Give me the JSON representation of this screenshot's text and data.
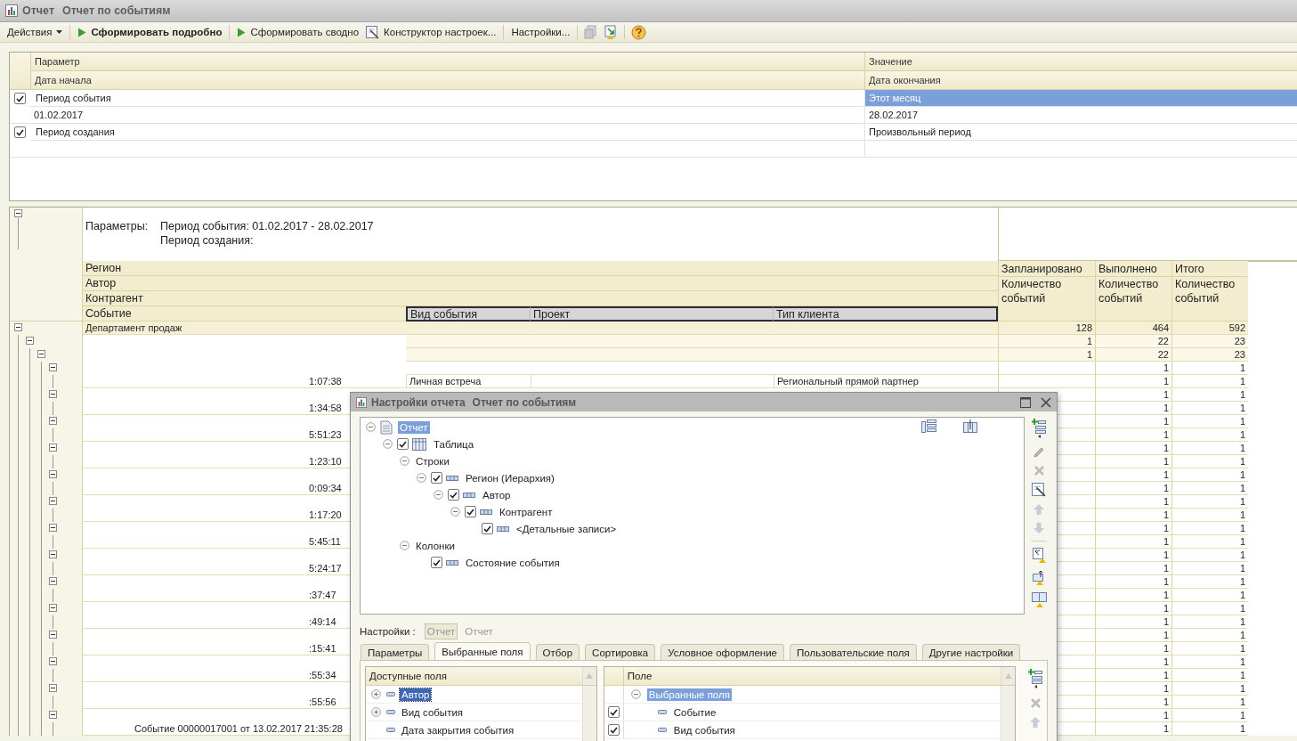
{
  "window": {
    "type": "Отчет",
    "title": "Отчет по событиям"
  },
  "toolbar": [
    {
      "kind": "menu",
      "label": "Действия"
    },
    {
      "kind": "separator"
    },
    {
      "kind": "run",
      "label": "Сформировать подробно",
      "bold": true
    },
    {
      "kind": "separator"
    },
    {
      "kind": "run",
      "label": "Сформировать сводно",
      "bold": false
    },
    {
      "kind": "wizard",
      "label": "Конструктор настроек..."
    },
    {
      "kind": "separator"
    },
    {
      "kind": "text",
      "label": "Настройки..."
    },
    {
      "kind": "separator"
    },
    {
      "kind": "load",
      "disabled": true
    },
    {
      "kind": "save",
      "disabled": false
    },
    {
      "kind": "separator"
    },
    {
      "kind": "help"
    }
  ],
  "parameters": {
    "columns": [
      "Параметр",
      "Значение"
    ],
    "subcolumns": [
      "Дата начала",
      "Дата окончания"
    ],
    "rows": [
      {
        "checked": true,
        "name": "Период события",
        "value": "Этот месяц",
        "selected": true,
        "start": "01.02.2017",
        "end": "28.02.2017"
      },
      {
        "checked": true,
        "name": "Период создания",
        "value": "Произвольный период",
        "selected": false
      }
    ]
  },
  "report": {
    "params_label": "Параметры:",
    "params": [
      "Период события: 01.02.2017 - 28.02.2017",
      "Период создания:"
    ],
    "expanded": true,
    "row_headers": [
      "Регион",
      "Автор",
      "Контрагент",
      "Событие"
    ],
    "event_columns": [
      "Вид события",
      "Проект",
      "Тип клиента"
    ],
    "measure_columns": [
      {
        "group": "Запланировано",
        "measure": "Количество событий"
      },
      {
        "group": "Выполнено",
        "measure": "Количество событий"
      },
      {
        "group": "Итого",
        "measure": "Количество событий"
      }
    ],
    "rows": [
      {
        "kind": "region",
        "label": "Департамент продаж",
        "expanded": true,
        "planned": "128",
        "done": "464",
        "total": "592",
        "children": [
          {
            "kind": "group",
            "expanded": true,
            "planned": "1",
            "done": "22",
            "total": "23",
            "children": [
              {
                "kind": "group",
                "expanded": true,
                "planned": "1",
                "done": "22",
                "total": "23",
                "children": [
                  {
                    "kind": "group",
                    "expanded": true,
                    "done": "1",
                    "total": "1",
                    "children": [
                      {
                        "kind": "event-partial",
                        "label": "1:07:38",
                        "event_type": "Личная встреча",
                        "client_type": "Региональный прямой партнер",
                        "done": "1",
                        "total": "1"
                      }
                    ]
                  },
                  {
                    "kind": "group",
                    "expanded": true,
                    "done": "1",
                    "total": "1",
                    "children": [
                      {
                        "kind": "event-partial",
                        "label": "1:34:58",
                        "done": "1",
                        "total": "1"
                      }
                    ]
                  },
                  {
                    "kind": "group",
                    "expanded": true,
                    "done": "1",
                    "total": "1",
                    "children": [
                      {
                        "kind": "event-partial",
                        "label": "5:51:23",
                        "done": "1",
                        "total": "1"
                      }
                    ]
                  },
                  {
                    "kind": "group",
                    "expanded": true,
                    "done": "1",
                    "total": "1",
                    "children": [
                      {
                        "kind": "event-partial",
                        "label": "1:23:10",
                        "done": "1",
                        "total": "1"
                      }
                    ]
                  },
                  {
                    "kind": "group",
                    "expanded": true,
                    "done": "1",
                    "total": "1",
                    "children": [
                      {
                        "kind": "event-partial",
                        "label": "0:09:34",
                        "done": "1",
                        "total": "1"
                      }
                    ]
                  },
                  {
                    "kind": "group",
                    "expanded": true,
                    "done": "1",
                    "total": "1",
                    "children": [
                      {
                        "kind": "event-partial",
                        "label": "1:17:20",
                        "done": "1",
                        "total": "1"
                      }
                    ]
                  },
                  {
                    "kind": "group",
                    "expanded": true,
                    "done": "1",
                    "total": "1",
                    "children": [
                      {
                        "kind": "event-partial",
                        "label": "5:45:11",
                        "done": "1",
                        "total": "1"
                      }
                    ]
                  },
                  {
                    "kind": "group",
                    "expanded": true,
                    "done": "1",
                    "total": "1",
                    "children": [
                      {
                        "kind": "event-partial",
                        "label": "5:24:17",
                        "done": "1",
                        "total": "1"
                      }
                    ]
                  },
                  {
                    "kind": "group",
                    "expanded": true,
                    "done": "1",
                    "total": "1",
                    "children": [
                      {
                        "kind": "event-partial",
                        "label": ":37:47",
                        "done": "1",
                        "total": "1"
                      }
                    ]
                  },
                  {
                    "kind": "group",
                    "expanded": true,
                    "done": "1",
                    "total": "1",
                    "children": [
                      {
                        "kind": "event-partial",
                        "label": ":49:14",
                        "done": "1",
                        "total": "1"
                      }
                    ]
                  },
                  {
                    "kind": "group",
                    "expanded": true,
                    "done": "1",
                    "total": "1",
                    "children": [
                      {
                        "kind": "event-partial",
                        "label": ":15:41",
                        "done": "1",
                        "total": "1"
                      }
                    ]
                  },
                  {
                    "kind": "group",
                    "expanded": true,
                    "done": "1",
                    "total": "1",
                    "children": [
                      {
                        "kind": "event-partial",
                        "label": ":55:34",
                        "done": "1",
                        "total": "1"
                      }
                    ]
                  },
                  {
                    "kind": "group",
                    "expanded": true,
                    "done": "1",
                    "total": "1",
                    "children": [
                      {
                        "kind": "event-partial",
                        "label": ":55:56",
                        "done": "1",
                        "total": "1"
                      }
                    ]
                  },
                  {
                    "kind": "group",
                    "expanded": true,
                    "done": "1",
                    "total": "1",
                    "children": [
                      {
                        "kind": "event",
                        "label": "Событие 00000017001 от 13.02.2017 21:35:28",
                        "done": "1",
                        "total": "1"
                      }
                    ]
                  }
                ]
              }
            ]
          }
        ]
      }
    ]
  },
  "settings_dialog": {
    "type": "Настройки отчета",
    "title": "Отчет по событиям",
    "tree": [
      {
        "kind": "report",
        "label": "Отчет",
        "selected": true,
        "expanded": true,
        "children": [
          {
            "kind": "table",
            "label": "Таблица",
            "checked": true,
            "expanded": true,
            "children": [
              {
                "label": "Строки",
                "expanded": true,
                "children": [
                  {
                    "kind": "field",
                    "label": "Регион (Иерархия)",
                    "checked": true,
                    "expanded": true,
                    "children": [
                      {
                        "kind": "field",
                        "label": "Автор",
                        "checked": true,
                        "expanded": true,
                        "children": [
                          {
                            "kind": "field",
                            "label": "Контрагент",
                            "checked": true,
                            "expanded": true,
                            "children": [
                              {
                                "kind": "field",
                                "label": "<Детальные записи>",
                                "checked": true
                              }
                            ]
                          }
                        ]
                      }
                    ]
                  }
                ]
              },
              {
                "label": "Колонки",
                "expanded": true,
                "children": [
                  {
                    "kind": "field",
                    "label": "Состояние события",
                    "checked": true
                  }
                ]
              }
            ]
          }
        ]
      }
    ],
    "settings_label": "Настройки :",
    "variants": [
      {
        "label": "Отчет",
        "selected": true
      },
      {
        "label": "Отчет",
        "selected": false
      }
    ],
    "tabs": [
      {
        "label": "Параметры",
        "selected": false
      },
      {
        "label": "Выбранные поля",
        "selected": true
      },
      {
        "label": "Отбор",
        "selected": false
      },
      {
        "label": "Сортировка",
        "selected": false
      },
      {
        "label": "Условное оформление",
        "selected": false
      },
      {
        "label": "Пользовательские поля",
        "selected": false
      },
      {
        "label": "Другие настройки",
        "selected": false
      }
    ],
    "available_fields": {
      "header": "Доступные поля",
      "items": [
        {
          "label": "Автор",
          "selected": true,
          "expanded": false
        },
        {
          "label": "Вид события",
          "selected": false,
          "expanded": false
        },
        {
          "label": "Дата закрытия события",
          "selected": false
        }
      ]
    },
    "selected_fields": {
      "header": "Поле",
      "items": [
        {
          "kind": "group",
          "label": "Выбранные поля",
          "selected": true,
          "expanded": true,
          "children": [
            {
              "kind": "field",
              "label": "Событие",
              "checked": true
            },
            {
              "kind": "field",
              "label": "Вид события",
              "checked": true
            }
          ]
        }
      ]
    }
  }
}
